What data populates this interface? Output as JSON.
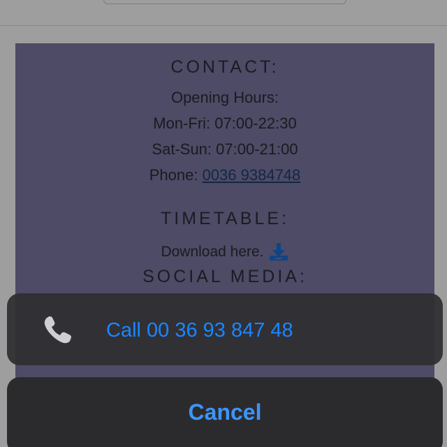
{
  "contact": {
    "heading": "CONTACT:",
    "opening_hours_label": "Opening Hours:",
    "weekday_hours": "Mon-Fri: 07:00-22:30",
    "weekend_hours": "Sat-Sun: 07:00-21:00",
    "phone_label": "Phone:",
    "phone_number": "0036 9384748"
  },
  "timetable": {
    "heading": "TIMETABLE:",
    "download_text": "Download here.",
    "download_icon": "download-icon"
  },
  "social": {
    "heading": "SOCIAL MEDIA:"
  },
  "action_sheet": {
    "call_icon": "phone-icon",
    "call_label": "Call 00 36 93 847 48",
    "cancel_label": "Cancel"
  },
  "colors": {
    "contact_background": "#7d7aa3",
    "action_blue": "#1b86ff",
    "sheet_background": "#2e2e32"
  }
}
